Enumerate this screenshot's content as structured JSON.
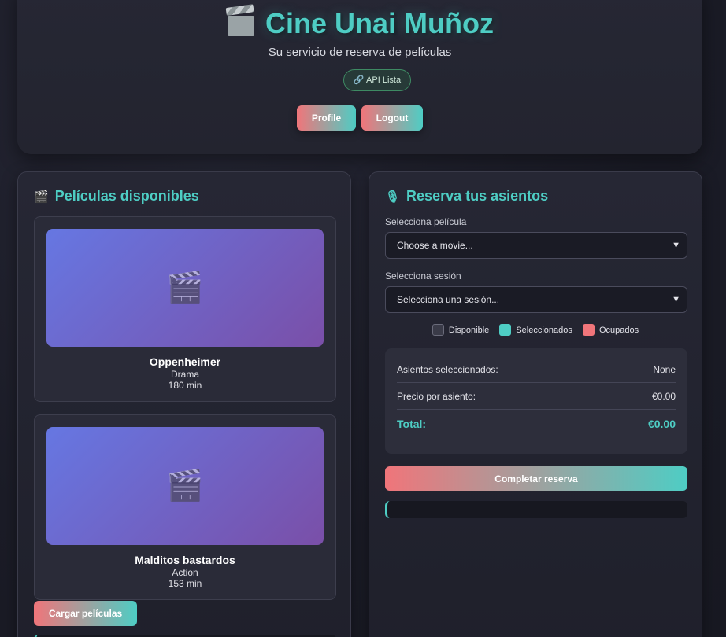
{
  "colors": {
    "accent": "#4ecdc4",
    "coral": "#f0757a",
    "available": "#3a3b48",
    "selected": "#4ecdc4",
    "occupied": "#f0757a"
  },
  "header": {
    "title": "Cine Unai Muñoz",
    "subtitle": "Su servicio de reserva de películas",
    "api_badge": "🔗 API Lista",
    "profile_label": "Profile",
    "logout_label": "Logout"
  },
  "movies_panel": {
    "icon": "🎬",
    "title": "Películas disponibles",
    "movies": [
      {
        "poster_icon": "🎬",
        "title": "Oppenheimer",
        "genre": "Drama",
        "duration": "180 min"
      },
      {
        "poster_icon": "🎬",
        "title": "Malditos bastardos",
        "genre": "Action",
        "duration": "153 min"
      }
    ],
    "load_label": "Cargar películas"
  },
  "booking_panel": {
    "icon": "🎙",
    "title": "Reserva tus asientos",
    "movie_label": "Selecciona película",
    "movie_value": "Choose a movie...",
    "session_label": "Selecciona sesión",
    "session_value": "Selecciona una sesión...",
    "legend": {
      "available": "Disponible",
      "selected": "Seleccionados",
      "occupied": "Ocupados"
    },
    "summary": {
      "seats_label": "Asientos seleccionados:",
      "seats_value": "None",
      "price_label": "Precio por asiento:",
      "price_value": "€0.00",
      "total_label": "Total:",
      "total_value": "€0.00"
    },
    "complete_label": "Completar reserva"
  }
}
